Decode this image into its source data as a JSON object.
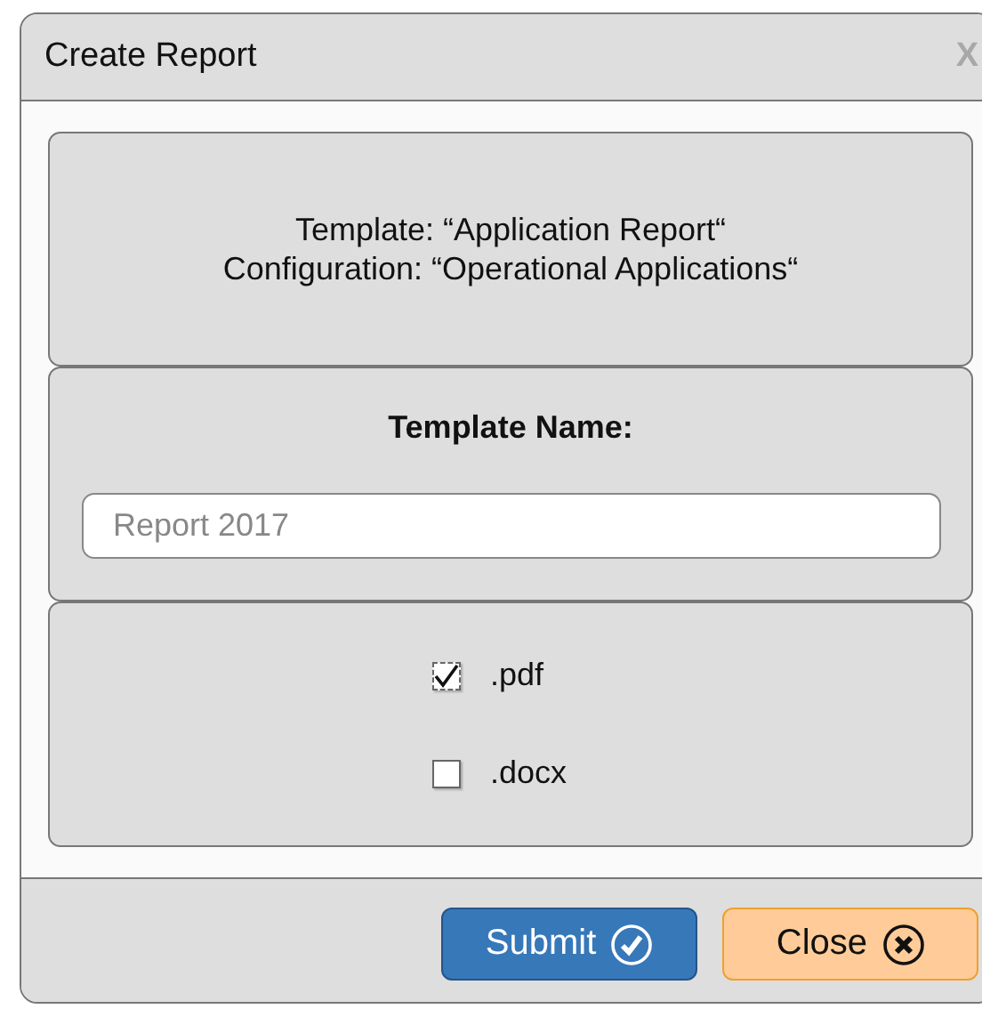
{
  "window": {
    "title": "Create Report",
    "close": "X"
  },
  "info": {
    "lines": [
      "Template: “Application Report“",
      "Configuration: “Operational Applications“"
    ]
  },
  "name_section": {
    "label": "Template Name:",
    "field": {
      "placeholder": "Report 2017"
    }
  },
  "formats": [
    {
      "label": ".pdf",
      "checked": true
    },
    {
      "label": ".docx",
      "checked": false
    }
  ],
  "buttons": [
    {
      "kind": "submit",
      "label": "Submit"
    },
    {
      "kind": "close",
      "label": "Close"
    }
  ]
}
